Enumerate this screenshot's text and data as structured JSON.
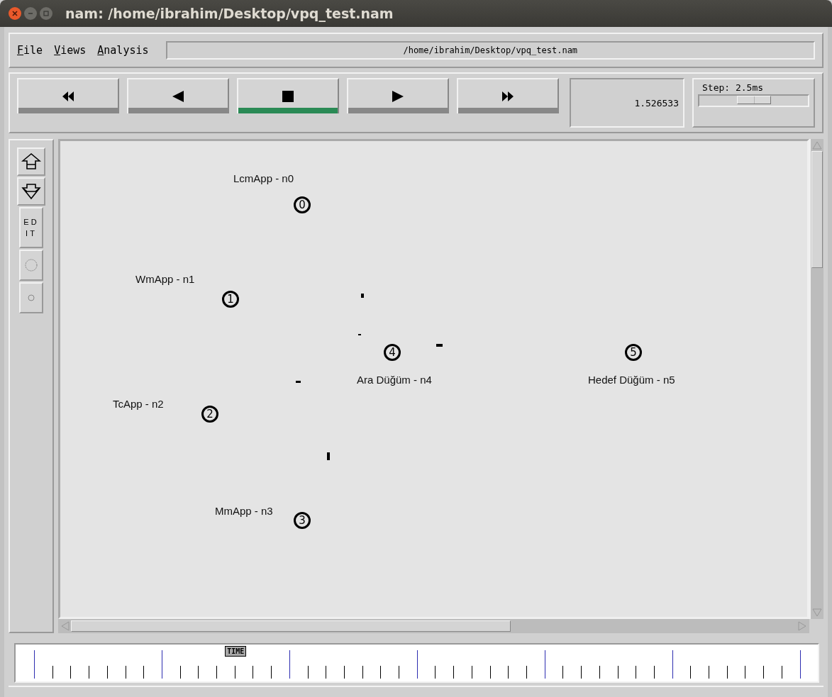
{
  "window": {
    "title": "nam: /home/ibrahim/Desktop/vpq_test.nam"
  },
  "menu": [
    {
      "mnemonic": "F",
      "rest": "ile"
    },
    {
      "mnemonic": "V",
      "rest": "iews"
    },
    {
      "mnemonic": "A",
      "rest": "nalysis"
    }
  ],
  "file_path": "/home/ibrahim/Desktop/vpq_test.nam",
  "playback": [
    {
      "kind": "rewind",
      "selected": false
    },
    {
      "kind": "back",
      "selected": false
    },
    {
      "kind": "stop",
      "selected": true
    },
    {
      "kind": "play",
      "selected": false
    },
    {
      "kind": "forward",
      "selected": false
    }
  ],
  "current_time": "1.526533",
  "step": {
    "label": "Step: 2.5ms",
    "level": 0.5
  },
  "tools": [
    {
      "kind": "zoom_in"
    },
    {
      "kind": "zoom_out"
    },
    {
      "kind": "edit",
      "label": "ED IT"
    },
    {
      "kind": "big_circle"
    },
    {
      "kind": "small_circle"
    }
  ],
  "nodes": [
    {
      "number": "0",
      "label": "LcmApp - n0"
    },
    {
      "number": "1",
      "label": "WmApp - n1"
    },
    {
      "number": "2",
      "label": "TcApp - n2"
    },
    {
      "number": "3",
      "label": "MmApp - n3"
    },
    {
      "number": "4",
      "label": "Ara Düğüm - n4"
    },
    {
      "number": "5",
      "label": "Hedef Düğüm - n5"
    }
  ],
  "timeline": {
    "marker": "TIME",
    "level": 0.284
  }
}
